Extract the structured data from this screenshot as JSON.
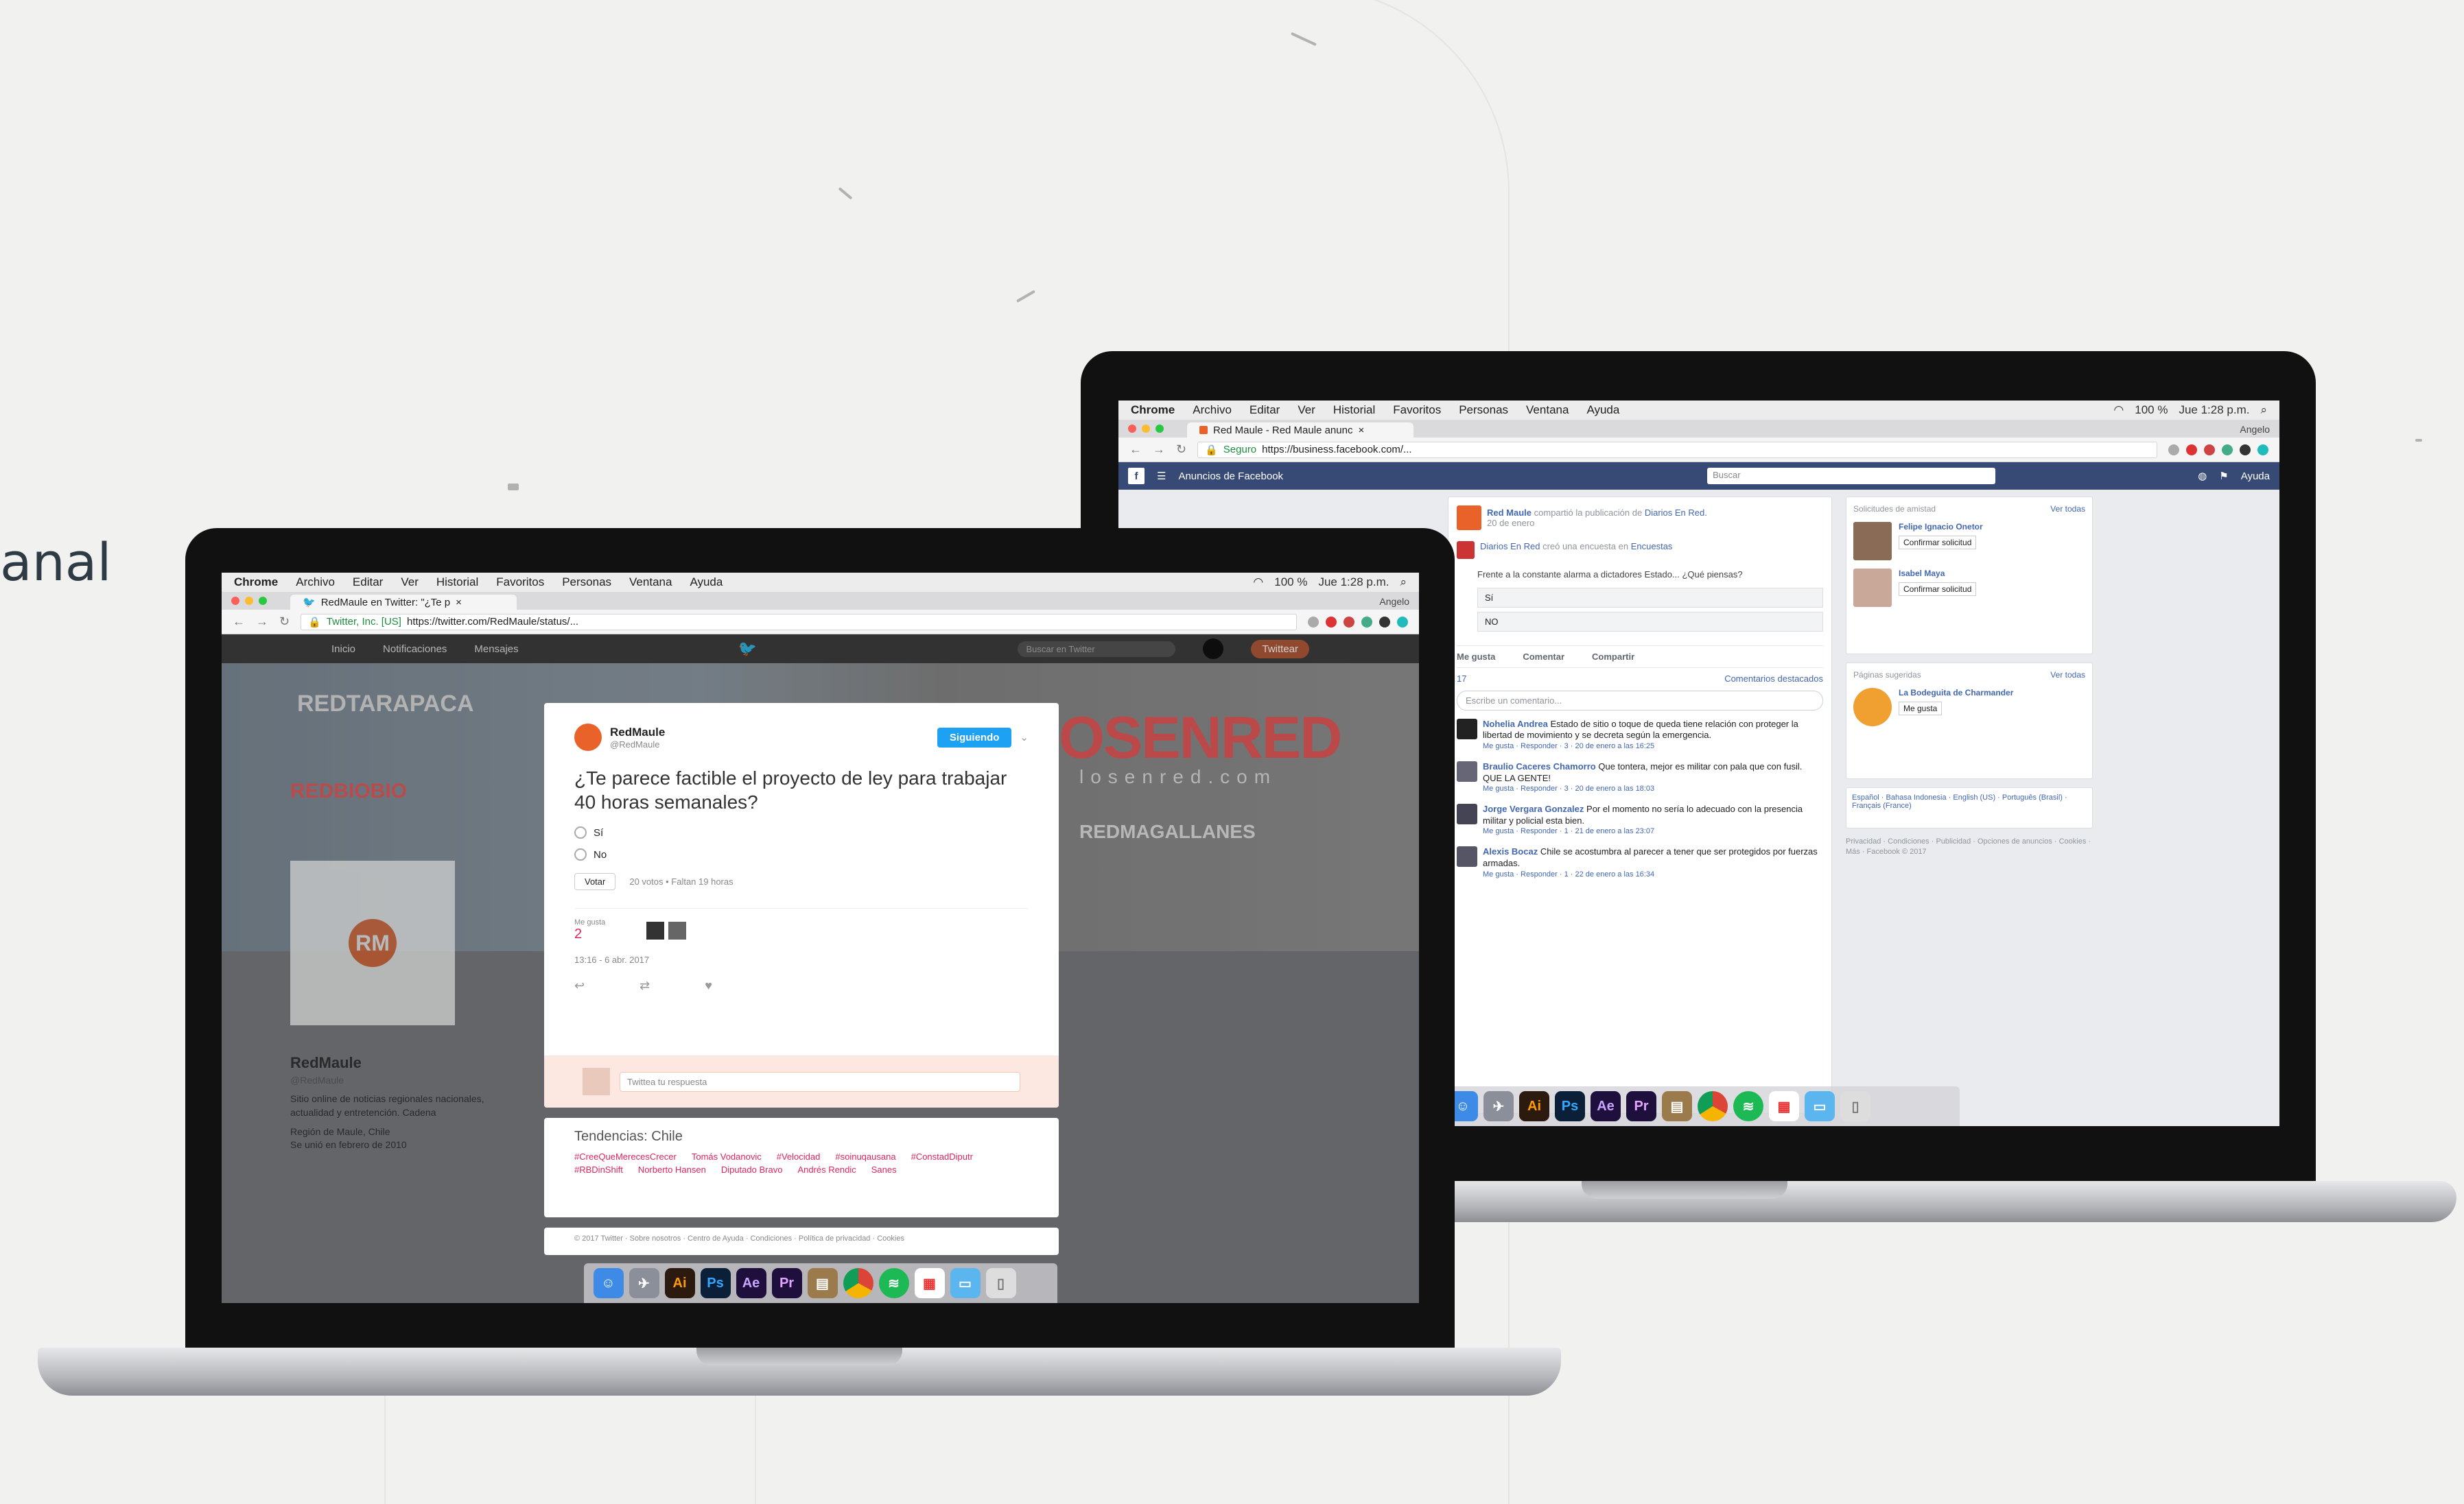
{
  "side_text": "anal",
  "mac": {
    "menu": [
      "Chrome",
      "Archivo",
      "Editar",
      "Ver",
      "Historial",
      "Favoritos",
      "Personas",
      "Ventana",
      "Ayuda"
    ],
    "clock": "Jue 1:28 p.m.",
    "battery": "100 %",
    "user": "Angelo"
  },
  "twitter": {
    "tab_title": "RedMaule en Twitter: \"¿Te p",
    "url_secure": "Twitter, Inc. [US]",
    "url": "https://twitter.com/RedMaule/status/...",
    "nav": [
      "Inicio",
      "Notificaciones",
      "Mensajes"
    ],
    "search_placeholder": "Buscar en Twitter",
    "tweet_button": "Twittear",
    "banner_left": "REDTARAPACA",
    "banner_mid": "REDBIOBIO",
    "banner_right": "OSENRED",
    "banner_sub": "losenred.com",
    "banner_region": "REDMAGALLANES",
    "profile": {
      "name": "RedMaule",
      "handle": "@RedMaule",
      "bio": "Sitio online de noticias regionales nacionales, actualidad y entretención. Cadena",
      "location": "Región de Maule, Chile",
      "joined": "Se unió en febrero de 2010",
      "logo": "RM"
    },
    "tweet": {
      "name": "RedMaule",
      "handle": "@RedMaule",
      "follow_button": "Siguiendo",
      "question": "¿Te parece factible el proyecto de ley para trabajar 40 horas semanales?",
      "options": [
        "Sí",
        "No"
      ],
      "vote_button": "Votar",
      "vote_meta": "20 votos • Faltan 19 horas",
      "likes_label": "Me gusta",
      "likes_count": "2",
      "timestamp": "13:16 - 6 abr. 2017",
      "reply_placeholder": "Twittea tu respuesta"
    },
    "trends": {
      "title": "Tendencias: Chile",
      "items": [
        "#CreeQueMerecesCrecer",
        "Tomás Vodanovic",
        "#Velocidad",
        "#soinuqausana",
        "#ConstadDiputr",
        "#RBDinShift",
        "Norberto Hansen",
        "Diputado Bravo",
        "Andrés Rendic",
        "Sanes"
      ]
    },
    "footer": "© 2017 Twitter · Sobre nosotros · Centro de Ayuda · Condiciones · Política de privacidad · Cookies"
  },
  "facebook": {
    "tab_title": "Red Maule - Red Maule anunc",
    "url_secure": "Seguro",
    "url": "https://business.facebook.com/...",
    "topbar": "Anuncios de Facebook",
    "search_placeholder": "Buscar",
    "help": "Ayuda",
    "post": {
      "author": "Red Maule",
      "action": "compartió la publicación de",
      "source": "Diarios En Red.",
      "time": "20 de enero",
      "shared_author": "Diarios En Red",
      "shared_action": "creó una encuesta en",
      "shared_place": "Encuestas",
      "body": "Frente a la constante alarma a dictadores Estado... ¿Qué piensas?",
      "poll_options": [
        "Sí",
        "NO"
      ],
      "actions": [
        "Me gusta",
        "Comentar",
        "Compartir"
      ],
      "reactions": "17",
      "comments_link": "Comentarios destacados",
      "comment_placeholder": "Escribe un comentario..."
    },
    "comments": [
      {
        "name": "Nohelia Andrea",
        "text": "Estado de sitio o toque de queda tiene relación con proteger la libertad de movimiento y se decreta según la emergencia.",
        "meta": "Me gusta · Responder · 3 · 20 de enero a las 16:25"
      },
      {
        "name": "Braulio Caceres Chamorro",
        "text": "Que tontera, mejor es militar con pala que con fusil. QUE LA GENTE!",
        "meta": "Me gusta · Responder · 3 · 20 de enero a las 18:03"
      },
      {
        "name": "Jorge Vergara Gonzalez",
        "text": "Por el momento no sería lo adecuado con la presencia militar y policial esta bien.",
        "meta": "Me gusta · Responder · 1 · 21 de enero a las 23:07"
      },
      {
        "name": "Alexis Bocaz",
        "text": "Chile se acostumbra al parecer a tener que ser protegidos por fuerzas armadas.",
        "meta": "Me gusta · Responder · 1 · 22 de enero a las 16:34"
      }
    ],
    "friend_requests": {
      "title": "Solicitudes de amistad",
      "see_all": "Ver todas",
      "items": [
        {
          "name": "Felipe Ignacio Onetor",
          "meta": "Confirmar solicitud"
        },
        {
          "name": "Isabel Maya",
          "meta": "Confirmar solicitud"
        }
      ]
    },
    "suggested": {
      "title": "Páginas sugeridas",
      "see_all": "Ver todas",
      "name": "La Bodeguita de Charmander",
      "meta": "Me gusta"
    },
    "languages": "Español · Bahasa Indonesia · English (US) · Português (Brasil) · Français (France)",
    "links": "Privacidad · Condiciones · Publicidad · Opciones de anuncios · Cookies · Más · Facebook © 2017"
  },
  "dock_apps": [
    "Ai",
    "Ps",
    "Ae",
    "Pr"
  ],
  "colors": {
    "twitter_blue": "#1da1f2",
    "facebook_blue": "#364a75",
    "redmaule_orange": "#e8622a"
  }
}
